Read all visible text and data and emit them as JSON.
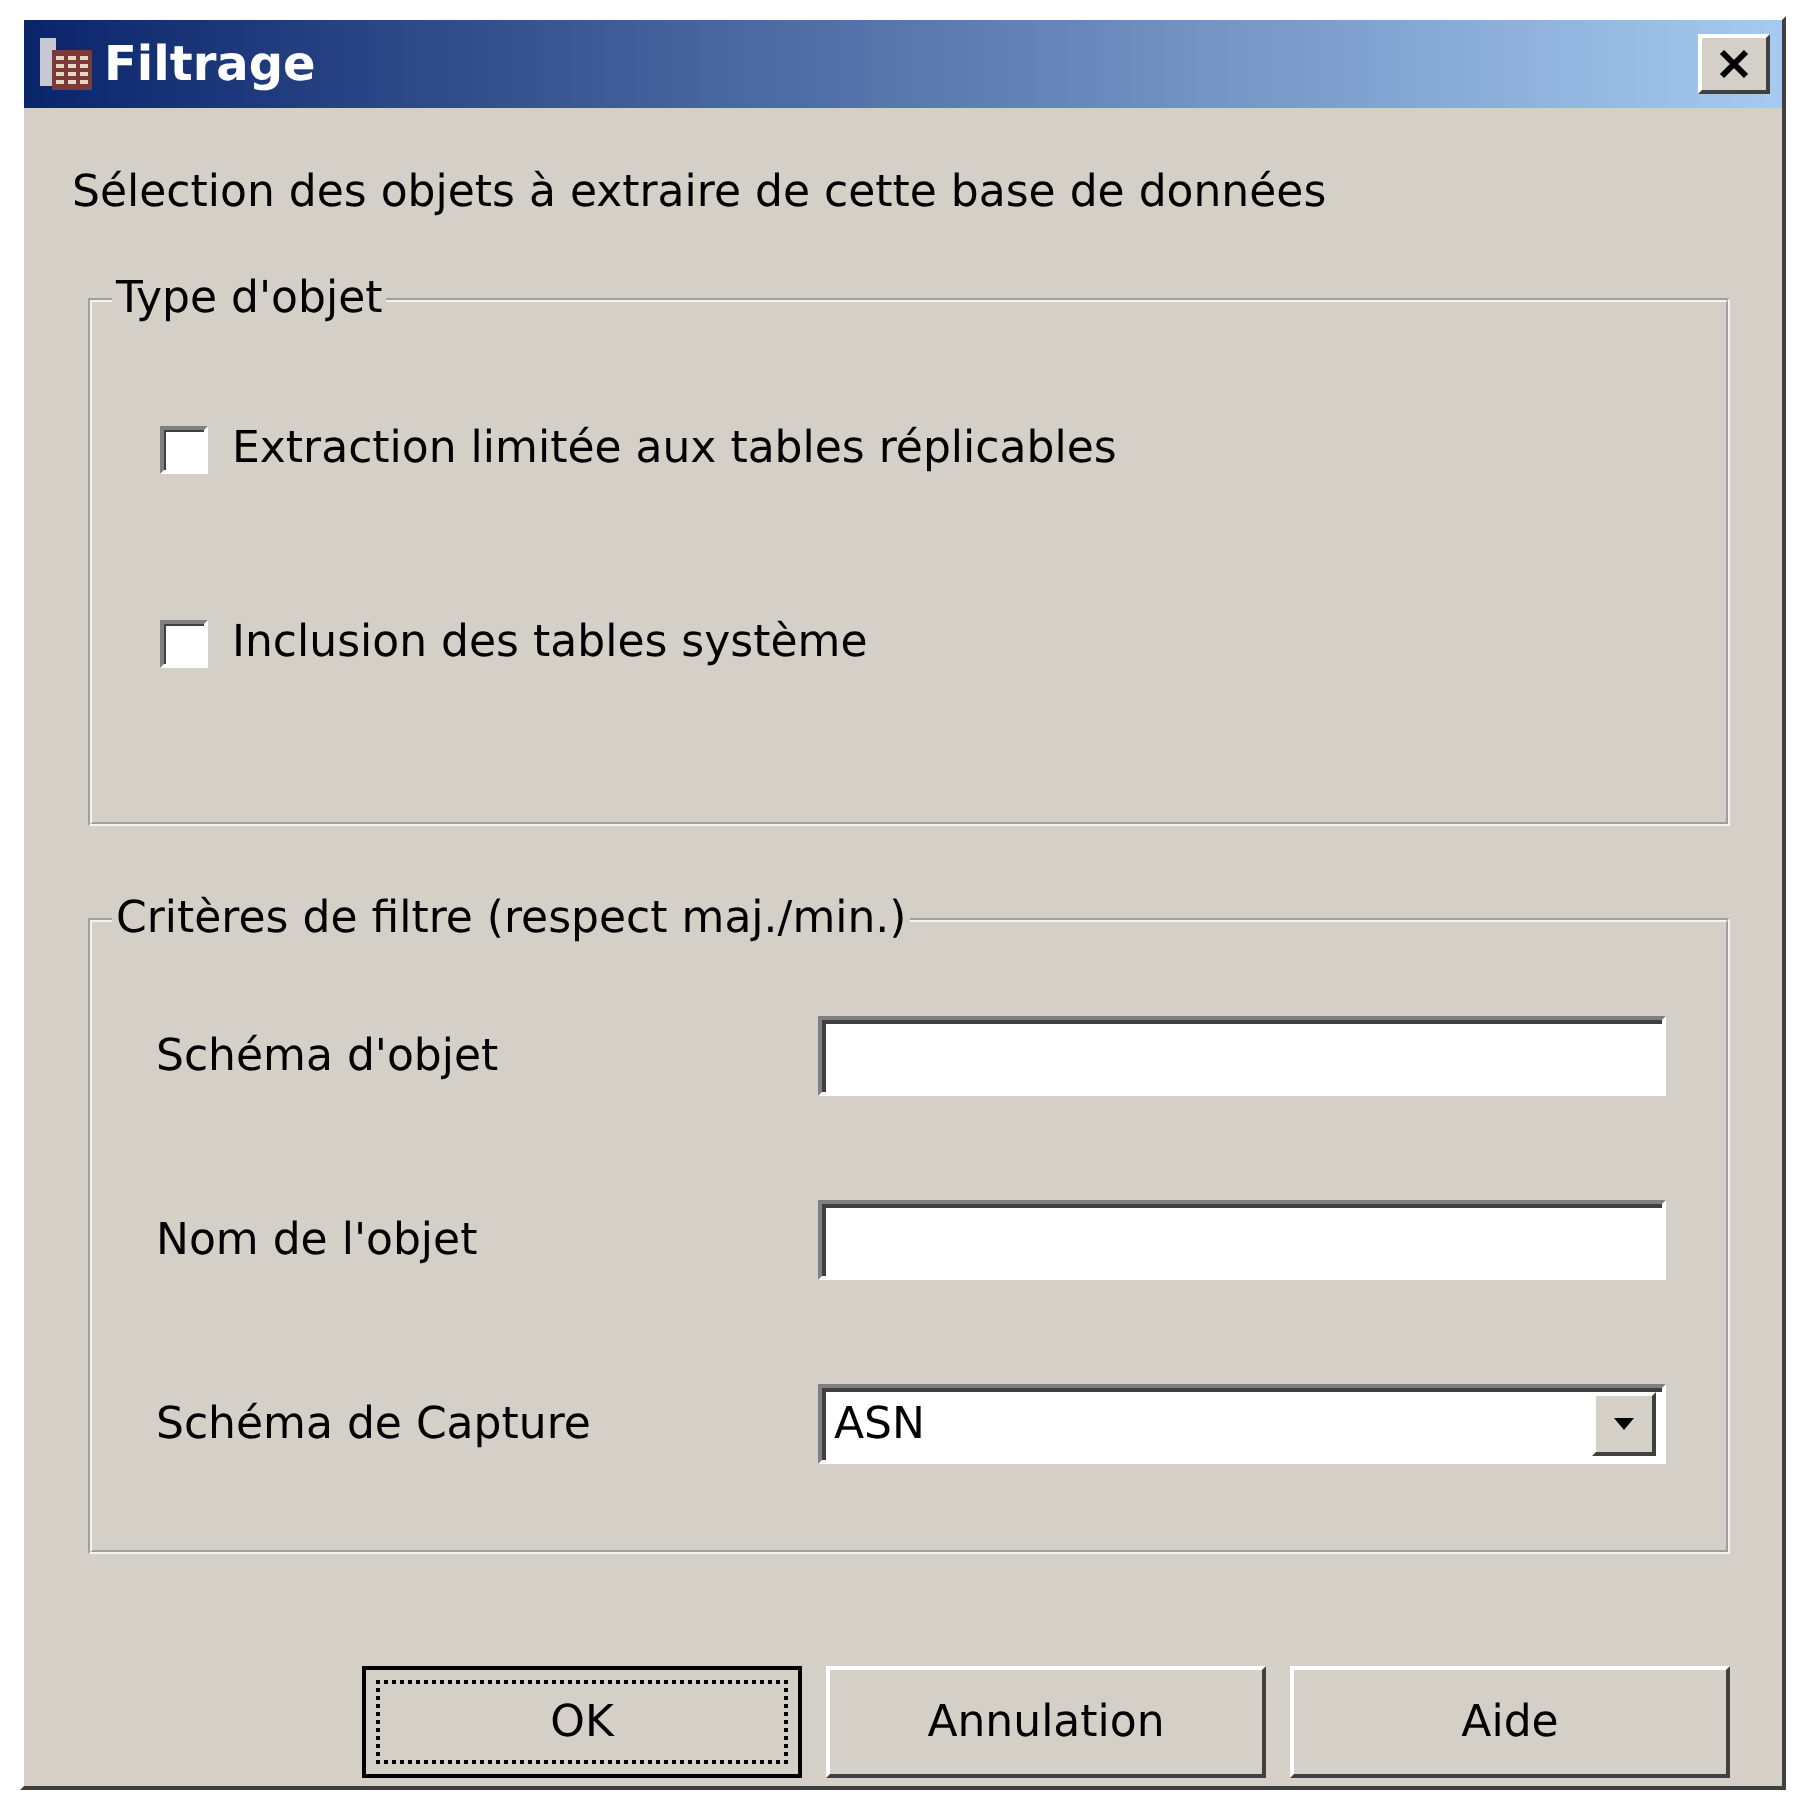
{
  "window": {
    "title": "Filtrage"
  },
  "intro": "Sélection des objets à extraire de cette base de données",
  "object_type": {
    "legend": "Type d'objet",
    "options": [
      {
        "label": "Extraction limitée aux tables réplicables",
        "checked": false
      },
      {
        "label": "Inclusion des tables système",
        "checked": false
      }
    ]
  },
  "filter": {
    "legend": "Critères de filtre (respect maj./min.)",
    "fields": [
      {
        "kind": "text",
        "label": "Schéma d'objet"
      },
      {
        "kind": "text",
        "label": "Nom de l'objet"
      },
      {
        "kind": "combo",
        "label": "Schéma de Capture",
        "value": "ASN"
      }
    ]
  },
  "buttons": [
    {
      "label": "OK",
      "focused": true
    },
    {
      "label": "Annulation",
      "focused": false
    },
    {
      "label": "Aide",
      "focused": false
    }
  ]
}
